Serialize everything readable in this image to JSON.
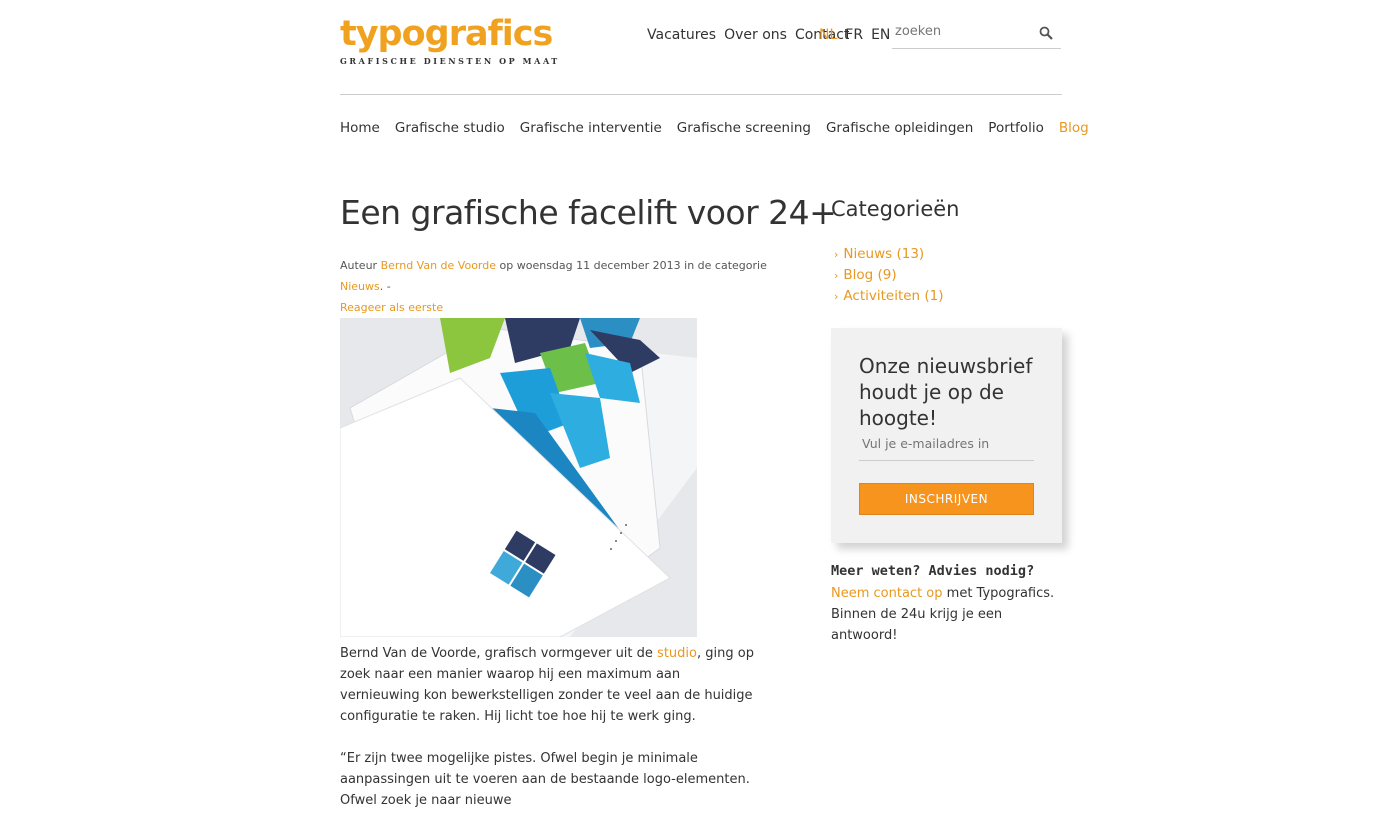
{
  "header": {
    "logo_text": "typografics",
    "logo_tagline": "GRAFISCHE DIENSTEN OP MAAT",
    "top_links": [
      "Vacatures",
      "Over ons",
      "Contact"
    ],
    "languages": [
      {
        "label": "NL",
        "active": true
      },
      {
        "label": "FR",
        "active": false
      },
      {
        "label": "EN",
        "active": false
      }
    ],
    "search_placeholder": "zoeken"
  },
  "nav": {
    "items": [
      "Home",
      "Grafische studio",
      "Grafische interventie",
      "Grafische screening",
      "Grafische opleidingen",
      "Portfolio",
      "Blog"
    ],
    "active": "Blog"
  },
  "article": {
    "title": "Een grafische facelift voor 24+",
    "meta": {
      "author_prefix": "Auteur",
      "author": "Bernd Van de Voorde",
      "date_text": "op woensdag 11 december 2013 in de categorie",
      "category": "Nieuws",
      "sep": ". -",
      "comment_link": "Reageer als eerste"
    },
    "paragraph1_before": "Bernd Van de Voorde, grafisch vormgever uit de",
    "paragraph1_link": "studio",
    "paragraph1_after": ", ging op zoek naar een manier waarop hij een maximum aan vernieuwing kon bewerkstelligen zonder te veel aan de huidige configuratie te raken. Hij licht toe hoe hij te werk ging.",
    "paragraph2": "“Er zijn twee mogelijke pistes. Ofwel begin je minimale aanpassingen uit te voeren aan de bestaande logo-elementen. Ofwel zoek je naar nieuwe"
  },
  "sidebar": {
    "categories_title": "Categorieën",
    "categories": [
      {
        "label": "Nieuws (13)"
      },
      {
        "label": "Blog (9)"
      },
      {
        "label": "Activiteiten (1)"
      }
    ],
    "newsletter": {
      "title": "Onze nieuwsbrief houdt je op de hoogte!",
      "placeholder": "Vul je e-mailadres in",
      "button": "INSCHRIJVEN"
    },
    "help": {
      "title": "Meer weten? Advies nodig?",
      "link": "Neem contact op",
      "text": "met Typografics. Binnen de 24u krijg je een antwoord!"
    }
  },
  "colors": {
    "accent": "#e8981f",
    "button": "#f7941d",
    "text": "#333333"
  }
}
